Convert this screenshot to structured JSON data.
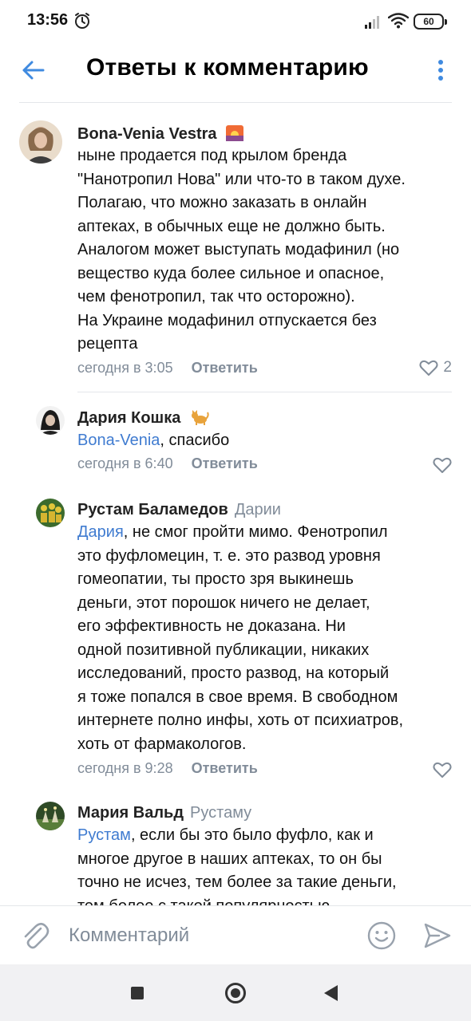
{
  "status_bar": {
    "time": "13:56",
    "battery": "60",
    "icons": [
      "alarm-icon",
      "signal-icon",
      "wifi-icon",
      "battery-icon"
    ]
  },
  "header": {
    "title": "Ответы к комментарию",
    "back_icon": "arrow-left-icon",
    "menu_icon": "vertical-dots-icon",
    "accent_color": "#3f8ae0"
  },
  "comments": [
    {
      "author": "Bona-Venia Vestra",
      "author_emoji": "sunset-emoji",
      "reply_to": "",
      "mention": "",
      "text": "ныне продается под крылом бренда\n\"Нанотропил Нова\" или что-то в таком духе.\nПолагаю, что можно заказать в онлайн\nаптеках, в обычных еще не должно быть.\nАналогом может выступать модафинил (но\nвещество куда более сильное и опасное,\nчем фенотропил, так что осторожно).\nНа Украине модафинил отпускается без\nрецепта",
      "time": "сегодня в 3:05",
      "reply_label": "Ответить",
      "likes": "2"
    },
    {
      "author": "Дария Кошка",
      "author_emoji": "cat-emoji",
      "reply_to": "",
      "mention": "Bona-Venia",
      "text": ", спасибо",
      "time": "сегодня в 6:40",
      "reply_label": "Ответить",
      "likes": ""
    },
    {
      "author": "Рустам Баламедов",
      "reply_to": "Дарии",
      "mention": "Дария",
      "text": ", не смог пройти мимо. Фенотропил\nэто фуфломецин, т. е. это развод уровня\nгомеопатии, ты просто зря выкинешь\nденьги, этот порошок ничего не делает,\nего эффективность не доказана. Ни\nодной позитивной публикации, никаких\nисследований, просто развод, на который\nя тоже попался в свое время. В свободном\nинтернете полно инфы, хоть от психиатров,\nхоть от фармакологов.",
      "time": "сегодня в 9:28",
      "reply_label": "Ответить",
      "likes": ""
    },
    {
      "author": "Мария Вальд",
      "reply_to": "Рустаму",
      "mention": "Рустам",
      "text": ", если бы это было фуфло, как и\nмногое другое в наших аптеках, то он бы\nточно не исчез, тем более за такие деньги,\nтем более с такой популярностью..."
    }
  ],
  "composer": {
    "placeholder": "Комментарий",
    "attach_icon": "paperclip-icon",
    "emoji_icon": "smile-icon",
    "send_icon": "send-icon"
  },
  "nav_bar": {
    "icons": [
      "recents-square-icon",
      "home-circle-icon",
      "back-triangle-icon"
    ]
  },
  "colors": {
    "link": "#3f7bd0",
    "secondary_text": "#818c99",
    "divider": "#e4e6ea"
  }
}
